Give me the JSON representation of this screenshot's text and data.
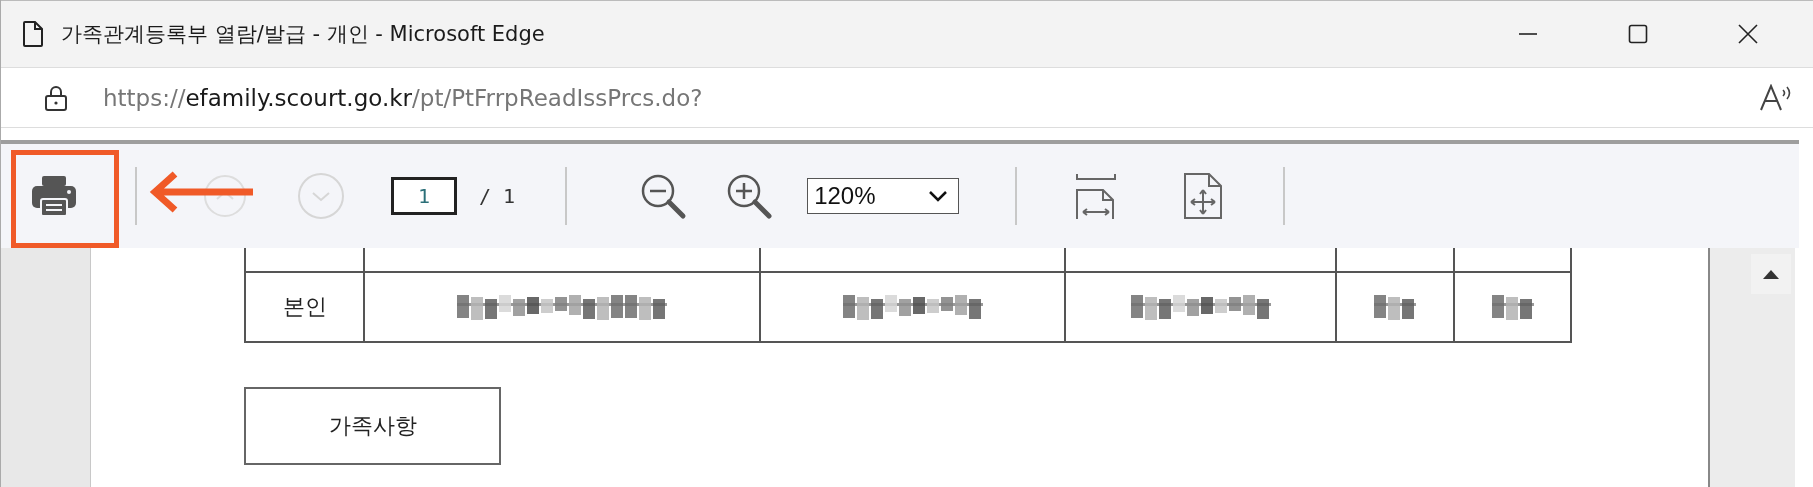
{
  "window": {
    "title": "가족관계등록부 열람/발급 - 개인 - Microsoft Edge"
  },
  "address_bar": {
    "url_prefix": "https://",
    "url_domain": "efamily.scourt.go.kr",
    "url_path": "/pt/PtFrrpReadIssPrcs.do?"
  },
  "pdf_toolbar": {
    "page_input": {
      "value": "1"
    },
    "page_total": "/ 1",
    "zoom_select": {
      "value": "120%"
    }
  },
  "document": {
    "table": {
      "rows": [
        {
          "cells": [
            {
              "kind": "text",
              "text": "본인"
            },
            {
              "kind": "blurred"
            },
            {
              "kind": "blurred"
            },
            {
              "kind": "blurred"
            },
            {
              "kind": "blurred"
            },
            {
              "kind": "blurred"
            }
          ]
        }
      ]
    },
    "section_label": "가족사항"
  }
}
